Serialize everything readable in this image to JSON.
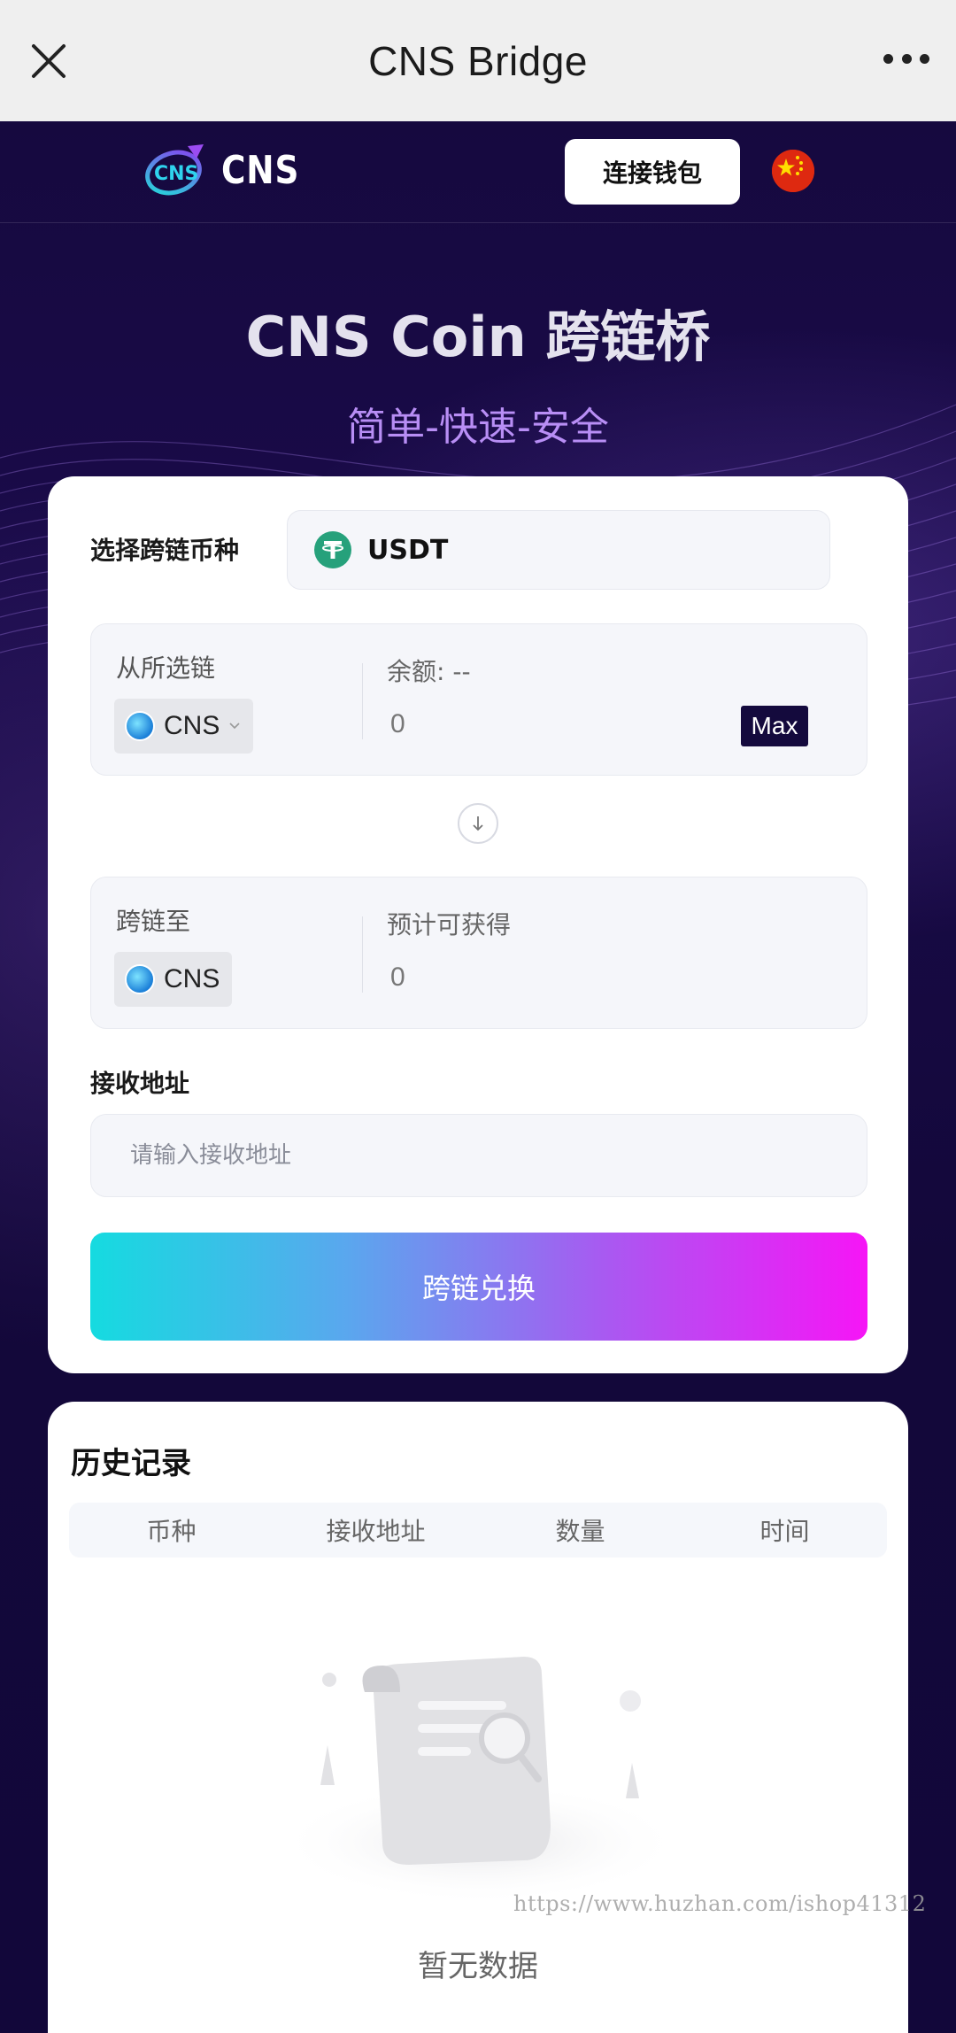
{
  "browser": {
    "title": "CNS Bridge",
    "close_icon": "close-icon",
    "more_icon": "more-dots-icon"
  },
  "header": {
    "logo_text": "CNS",
    "connect_label": "连接钱包",
    "language_icon": "china-flag-icon"
  },
  "hero": {
    "title": "CNS Coin 跨链桥",
    "subtitle": "简单-快速-安全"
  },
  "bridge": {
    "select_label": "选择跨链币种",
    "token": "USDT",
    "from": {
      "label": "从所选链",
      "chain": "CNS",
      "balance_label": "余额: --",
      "amount": "0",
      "max_label": "Max"
    },
    "to": {
      "label": "跨链至",
      "chain": "CNS",
      "estimate_label": "预计可获得",
      "amount": "0"
    },
    "receive_label": "接收地址",
    "receive_placeholder": "请输入接收地址",
    "receive_value": "",
    "submit_label": "跨链兑换",
    "colors": {
      "gradient_start": "#15dbe0",
      "gradient_end": "#f615f6",
      "max_bg": "#140a3d",
      "usdt": "#26a17b"
    }
  },
  "history": {
    "title": "历史记录",
    "columns": [
      "币种",
      "接收地址",
      "数量",
      "时间"
    ],
    "rows": [],
    "empty_text": "暂无数据"
  },
  "watermark": "https://www.huzhan.com/ishop41312"
}
